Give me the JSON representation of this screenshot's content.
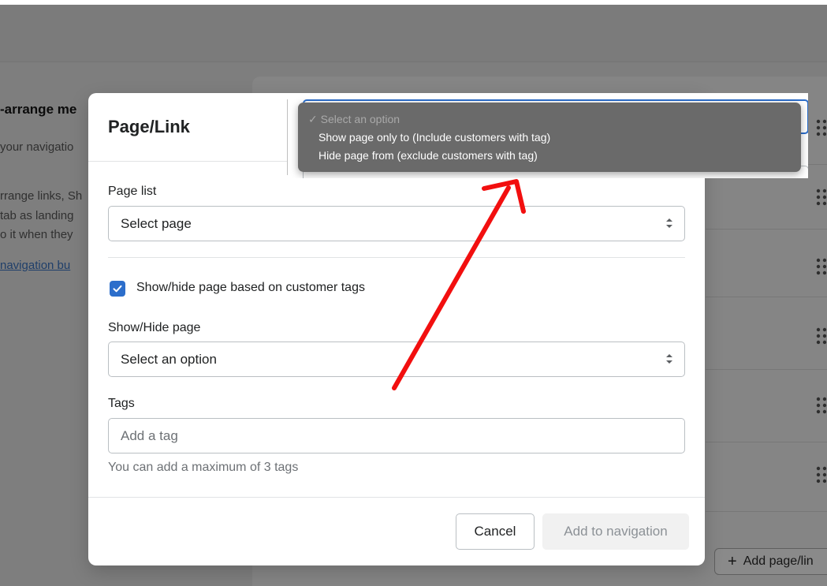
{
  "background": {
    "heading": "-arrange me",
    "line1": "your navigatio",
    "line2": "rrange links, Sh",
    "line3": "tab as landing",
    "line4": "o it when they",
    "link": "navigation bu",
    "add_page_label": "Add page/lin"
  },
  "modal": {
    "title": "Page/Link",
    "page_list": {
      "label": "Page list",
      "value": "Select page"
    },
    "checkbox": {
      "label": "Show/hide page based on customer tags",
      "checked": true
    },
    "show_hide": {
      "label": "Show/Hide page",
      "value": "Select an option"
    },
    "tags": {
      "label": "Tags",
      "placeholder": "Add a tag",
      "help": "You can add a maximum of 3 tags"
    },
    "buttons": {
      "cancel": "Cancel",
      "add": "Add to navigation"
    }
  },
  "dropdown": {
    "options": [
      {
        "label": "Select an option",
        "selected": true
      },
      {
        "label": "Show page only to (Include customers with tag)",
        "selected": false
      },
      {
        "label": "Hide page from (exclude customers with tag)",
        "selected": false
      }
    ]
  },
  "colors": {
    "primary": "#2c6ecb",
    "annotation_arrow": "#f20f0f"
  }
}
